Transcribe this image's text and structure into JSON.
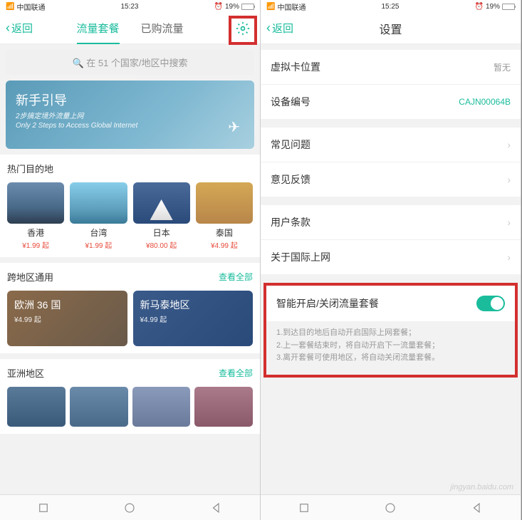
{
  "left": {
    "status": {
      "carrier": "中国联通",
      "time": "15:23",
      "battery": "19%"
    },
    "nav": {
      "back": "返回",
      "tab1": "流量套餐",
      "tab2": "已购流量"
    },
    "search": {
      "placeholder": "在 51 个国家/地区中搜索"
    },
    "hero": {
      "title": "新手引导",
      "sub1": "2步搞定境外流量上网",
      "sub2": "Only 2 Steps to Access Global Internet"
    },
    "hot": {
      "title": "热门目的地",
      "items": [
        {
          "name": "香港",
          "price": "¥1.99 起"
        },
        {
          "name": "台湾",
          "price": "¥1.99 起"
        },
        {
          "name": "日本",
          "price": "¥80.00 起"
        },
        {
          "name": "泰国",
          "price": "¥4.99 起"
        }
      ]
    },
    "cross": {
      "title": "跨地区通用",
      "viewall": "查看全部",
      "items": [
        {
          "name": "欧洲 36 国",
          "price": "¥4.99 起"
        },
        {
          "name": "新马泰地区",
          "price": "¥4.99 起"
        }
      ]
    },
    "asia": {
      "title": "亚洲地区",
      "viewall": "查看全部"
    }
  },
  "right": {
    "status": {
      "carrier": "中国联通",
      "time": "15:25",
      "battery": "19%"
    },
    "nav": {
      "back": "返回",
      "title": "设置"
    },
    "rows": {
      "vcard": {
        "label": "虚拟卡位置",
        "value": "暂无"
      },
      "device": {
        "label": "设备编号",
        "value": "CAJN00064B"
      },
      "faq": {
        "label": "常见问题"
      },
      "feedback": {
        "label": "意见反馈"
      },
      "terms": {
        "label": "用户条款"
      },
      "about": {
        "label": "关于国际上网"
      }
    },
    "toggle": {
      "label": "智能开启/关闭流量套餐",
      "desc1": "1.到达目的地后自动开启国际上网套餐；",
      "desc2": "2.上一套餐结束时，将自动开启下一流量套餐；",
      "desc3": "3.离开套餐可使用地区，将自动关闭流量套餐。"
    },
    "watermark": "jingyan.baidu.com"
  }
}
